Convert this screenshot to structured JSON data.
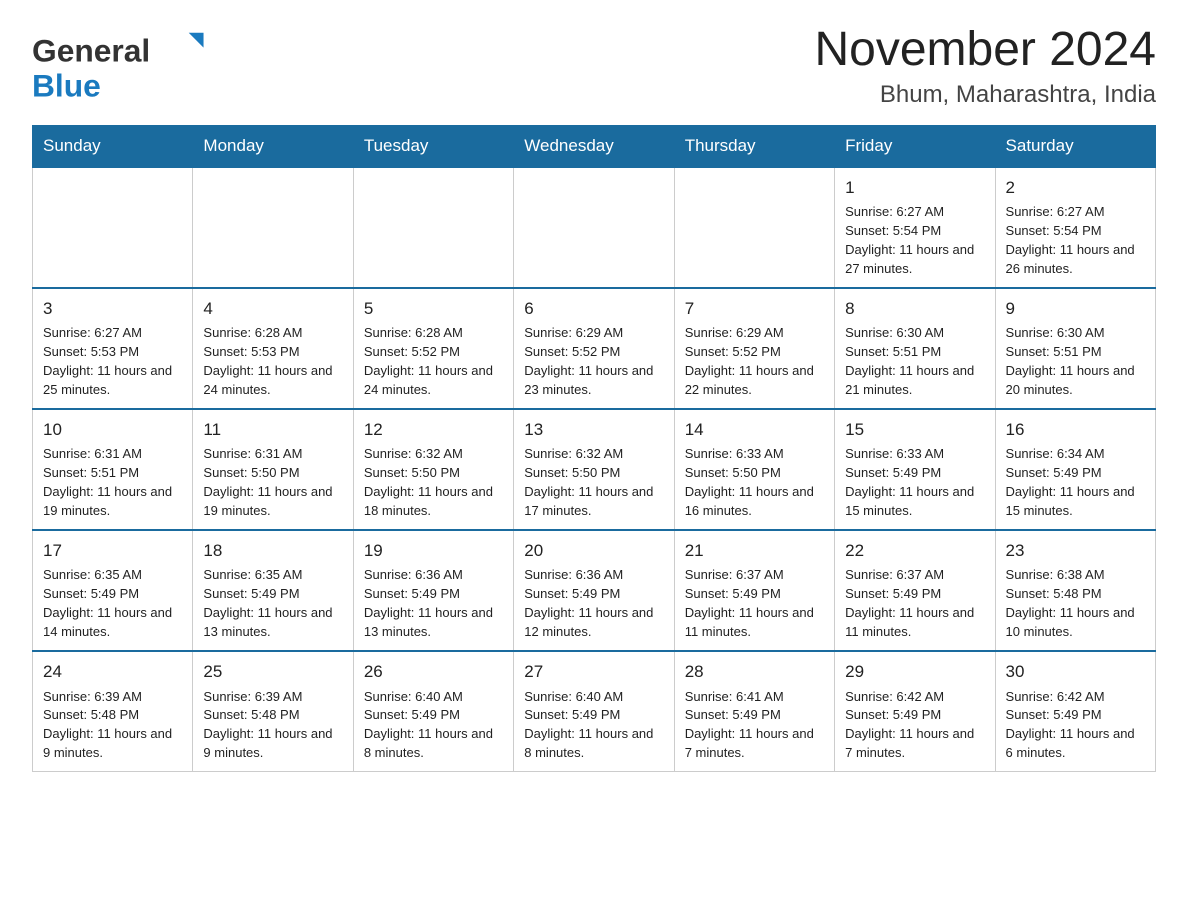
{
  "header": {
    "logo": {
      "general_text": "General",
      "blue_text": "Blue"
    },
    "month_title": "November 2024",
    "location": "Bhum, Maharashtra, India"
  },
  "days_of_week": [
    "Sunday",
    "Monday",
    "Tuesday",
    "Wednesday",
    "Thursday",
    "Friday",
    "Saturday"
  ],
  "weeks": [
    {
      "days": [
        {
          "number": "",
          "info": ""
        },
        {
          "number": "",
          "info": ""
        },
        {
          "number": "",
          "info": ""
        },
        {
          "number": "",
          "info": ""
        },
        {
          "number": "",
          "info": ""
        },
        {
          "number": "1",
          "info": "Sunrise: 6:27 AM\nSunset: 5:54 PM\nDaylight: 11 hours and 27 minutes."
        },
        {
          "number": "2",
          "info": "Sunrise: 6:27 AM\nSunset: 5:54 PM\nDaylight: 11 hours and 26 minutes."
        }
      ]
    },
    {
      "days": [
        {
          "number": "3",
          "info": "Sunrise: 6:27 AM\nSunset: 5:53 PM\nDaylight: 11 hours and 25 minutes."
        },
        {
          "number": "4",
          "info": "Sunrise: 6:28 AM\nSunset: 5:53 PM\nDaylight: 11 hours and 24 minutes."
        },
        {
          "number": "5",
          "info": "Sunrise: 6:28 AM\nSunset: 5:52 PM\nDaylight: 11 hours and 24 minutes."
        },
        {
          "number": "6",
          "info": "Sunrise: 6:29 AM\nSunset: 5:52 PM\nDaylight: 11 hours and 23 minutes."
        },
        {
          "number": "7",
          "info": "Sunrise: 6:29 AM\nSunset: 5:52 PM\nDaylight: 11 hours and 22 minutes."
        },
        {
          "number": "8",
          "info": "Sunrise: 6:30 AM\nSunset: 5:51 PM\nDaylight: 11 hours and 21 minutes."
        },
        {
          "number": "9",
          "info": "Sunrise: 6:30 AM\nSunset: 5:51 PM\nDaylight: 11 hours and 20 minutes."
        }
      ]
    },
    {
      "days": [
        {
          "number": "10",
          "info": "Sunrise: 6:31 AM\nSunset: 5:51 PM\nDaylight: 11 hours and 19 minutes."
        },
        {
          "number": "11",
          "info": "Sunrise: 6:31 AM\nSunset: 5:50 PM\nDaylight: 11 hours and 19 minutes."
        },
        {
          "number": "12",
          "info": "Sunrise: 6:32 AM\nSunset: 5:50 PM\nDaylight: 11 hours and 18 minutes."
        },
        {
          "number": "13",
          "info": "Sunrise: 6:32 AM\nSunset: 5:50 PM\nDaylight: 11 hours and 17 minutes."
        },
        {
          "number": "14",
          "info": "Sunrise: 6:33 AM\nSunset: 5:50 PM\nDaylight: 11 hours and 16 minutes."
        },
        {
          "number": "15",
          "info": "Sunrise: 6:33 AM\nSunset: 5:49 PM\nDaylight: 11 hours and 15 minutes."
        },
        {
          "number": "16",
          "info": "Sunrise: 6:34 AM\nSunset: 5:49 PM\nDaylight: 11 hours and 15 minutes."
        }
      ]
    },
    {
      "days": [
        {
          "number": "17",
          "info": "Sunrise: 6:35 AM\nSunset: 5:49 PM\nDaylight: 11 hours and 14 minutes."
        },
        {
          "number": "18",
          "info": "Sunrise: 6:35 AM\nSunset: 5:49 PM\nDaylight: 11 hours and 13 minutes."
        },
        {
          "number": "19",
          "info": "Sunrise: 6:36 AM\nSunset: 5:49 PM\nDaylight: 11 hours and 13 minutes."
        },
        {
          "number": "20",
          "info": "Sunrise: 6:36 AM\nSunset: 5:49 PM\nDaylight: 11 hours and 12 minutes."
        },
        {
          "number": "21",
          "info": "Sunrise: 6:37 AM\nSunset: 5:49 PM\nDaylight: 11 hours and 11 minutes."
        },
        {
          "number": "22",
          "info": "Sunrise: 6:37 AM\nSunset: 5:49 PM\nDaylight: 11 hours and 11 minutes."
        },
        {
          "number": "23",
          "info": "Sunrise: 6:38 AM\nSunset: 5:48 PM\nDaylight: 11 hours and 10 minutes."
        }
      ]
    },
    {
      "days": [
        {
          "number": "24",
          "info": "Sunrise: 6:39 AM\nSunset: 5:48 PM\nDaylight: 11 hours and 9 minutes."
        },
        {
          "number": "25",
          "info": "Sunrise: 6:39 AM\nSunset: 5:48 PM\nDaylight: 11 hours and 9 minutes."
        },
        {
          "number": "26",
          "info": "Sunrise: 6:40 AM\nSunset: 5:49 PM\nDaylight: 11 hours and 8 minutes."
        },
        {
          "number": "27",
          "info": "Sunrise: 6:40 AM\nSunset: 5:49 PM\nDaylight: 11 hours and 8 minutes."
        },
        {
          "number": "28",
          "info": "Sunrise: 6:41 AM\nSunset: 5:49 PM\nDaylight: 11 hours and 7 minutes."
        },
        {
          "number": "29",
          "info": "Sunrise: 6:42 AM\nSunset: 5:49 PM\nDaylight: 11 hours and 7 minutes."
        },
        {
          "number": "30",
          "info": "Sunrise: 6:42 AM\nSunset: 5:49 PM\nDaylight: 11 hours and 6 minutes."
        }
      ]
    }
  ]
}
